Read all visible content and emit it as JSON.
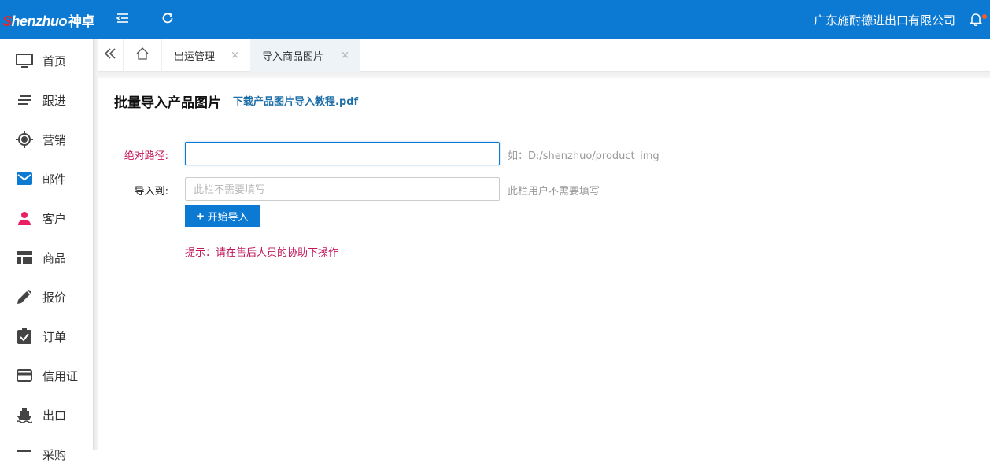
{
  "header": {
    "logo_latin": "Shenzhuo",
    "logo_cn": "神卓",
    "company": "广东施耐德进出口有限公司",
    "accent_color": "#0c7ad3"
  },
  "sidebar": {
    "items": [
      {
        "label": "首页",
        "icon": "monitor-icon"
      },
      {
        "label": "跟进",
        "icon": "lines-icon"
      },
      {
        "label": "营销",
        "icon": "target-icon"
      },
      {
        "label": "邮件",
        "icon": "mail-icon"
      },
      {
        "label": "客户",
        "icon": "user-icon"
      },
      {
        "label": "商品",
        "icon": "grid-icon"
      },
      {
        "label": "报价",
        "icon": "pencil-icon"
      },
      {
        "label": "订单",
        "icon": "clipboard-check-icon"
      },
      {
        "label": "信用证",
        "icon": "credit-card-icon"
      },
      {
        "label": "出口",
        "icon": "ship-icon"
      },
      {
        "label": "采购",
        "icon": "cart-icon"
      }
    ]
  },
  "tabs": [
    {
      "label": "出运管理",
      "close": "×"
    },
    {
      "label": "导入商品图片",
      "close": "×",
      "active": true
    }
  ],
  "main": {
    "title": "批量导入产品图片",
    "pdf_link": "下载产品图片导入教程.pdf",
    "path_label": "绝对路径:",
    "path_value": "",
    "path_hint": "如：D:/shenzhuo/product_img",
    "import_to_label": "导入到:",
    "import_to_placeholder": "此栏不需要填写",
    "import_to_hint": "此栏用户不需要填写",
    "start_button": "开始导入",
    "tip": "提示：请在售后人员的协助下操作"
  }
}
